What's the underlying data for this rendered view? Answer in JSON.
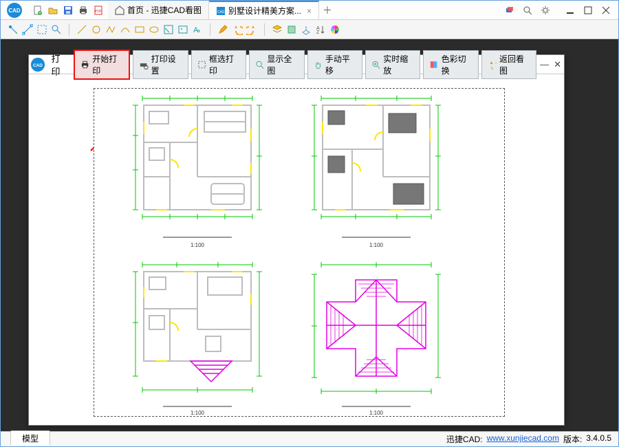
{
  "titlebar": {
    "tabs": [
      {
        "label": "首页 - 迅捷CAD看图",
        "active": false
      },
      {
        "label": "别墅设计精美方案...",
        "active": true
      }
    ]
  },
  "print_panel": {
    "title": "打印",
    "start_print": "开始打印",
    "print_settings": "打印设置",
    "box_select_print": "框选打印",
    "show_all": "显示全图",
    "pan": "手动平移",
    "realtime_zoom": "实时缩放",
    "color_toggle": "色彩切换",
    "back_to_view": "返回看图"
  },
  "drawings": {
    "scale_label_1": "1:100",
    "scale_label_2": "1:100",
    "scale_label_3": "1:100",
    "scale_label_4": "1:100"
  },
  "footer": {
    "model_tab": "模型",
    "brand": "迅捷CAD:",
    "url_text": "www.xunjiecad.com",
    "version_label": "版本:",
    "version": "3.4.0.5"
  },
  "colors": {
    "accent": "#3b8fd9",
    "highlight_red": "#e11",
    "plan_wall": "#bdbdbd",
    "plan_door": "#ffe600",
    "plan_dim": "#00c800",
    "plan_roof": "#e400e4"
  }
}
